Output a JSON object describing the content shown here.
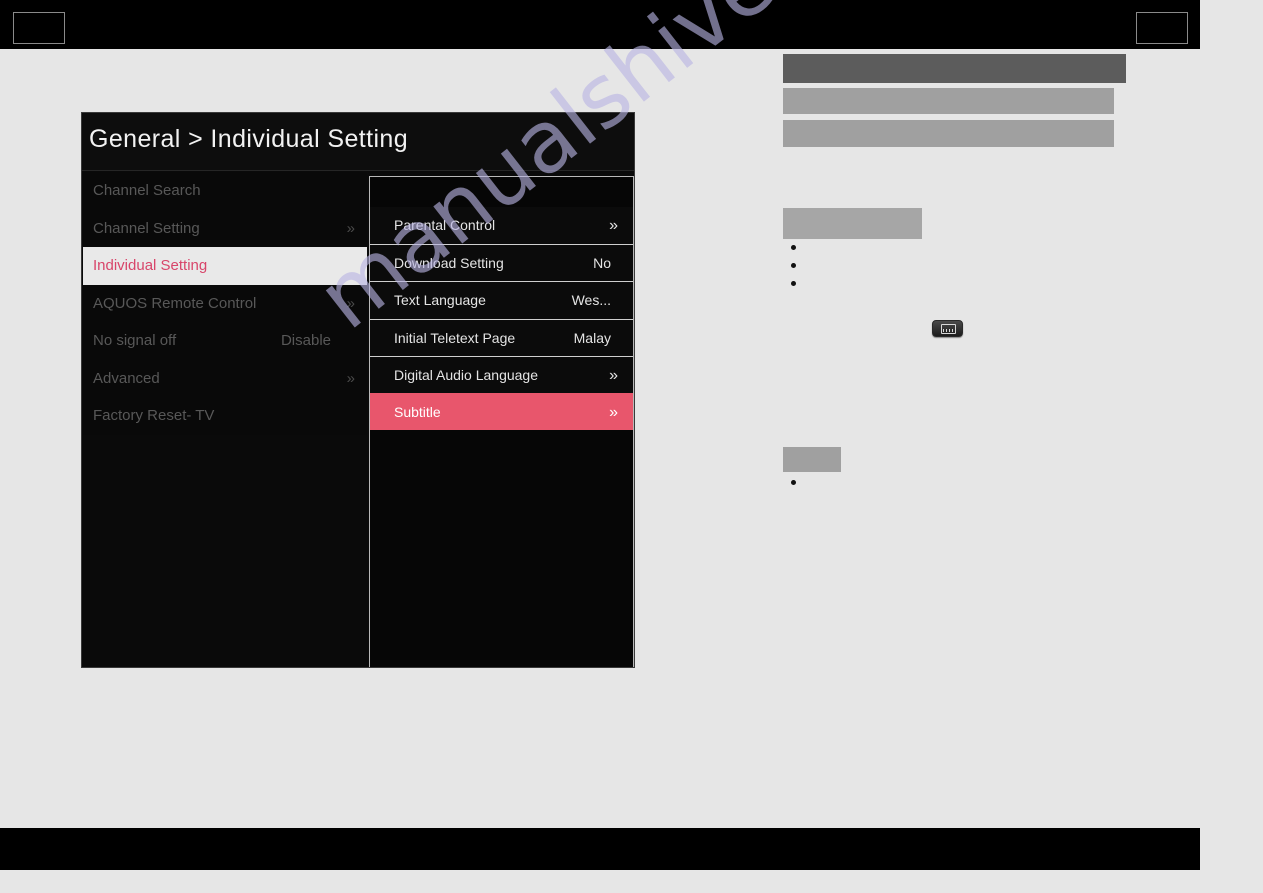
{
  "page": {
    "watermark": "manualshive.com",
    "background_color": "#e6e6e6",
    "band_color": "#000000"
  },
  "header": {
    "left_box_label": "",
    "right_box_label": ""
  },
  "osd": {
    "title": "General > Individual Setting",
    "panel_background": "#0a0a0a",
    "selected_color": "#d8456a",
    "highlight_color": "#e8566c",
    "left_menu": [
      {
        "label": "Channel Search",
        "value": "",
        "arrow": "",
        "selected": false
      },
      {
        "label": "Channel Setting",
        "value": "",
        "arrow": "»",
        "selected": false
      },
      {
        "label": "Individual Setting",
        "value": "",
        "arrow": "",
        "selected": true
      },
      {
        "label": "AQUOS Remote Control",
        "value": "",
        "arrow": "»",
        "selected": false
      },
      {
        "label": "No signal off",
        "value": "Disable",
        "arrow": "",
        "selected": false
      },
      {
        "label": "Advanced",
        "value": "",
        "arrow": "»",
        "selected": false
      },
      {
        "label": "Factory Reset- TV",
        "value": "",
        "arrow": "",
        "selected": false
      }
    ],
    "submenu": [
      {
        "label": "Parental Control",
        "value": "",
        "arrow": "»",
        "highlight": false
      },
      {
        "label": "Download Setting",
        "value": "No",
        "arrow": "",
        "highlight": false
      },
      {
        "label": "Text Language",
        "value": "Wes...",
        "arrow": "",
        "highlight": false
      },
      {
        "label": "Initial Teletext Page",
        "value": "Malay",
        "arrow": "",
        "highlight": false
      },
      {
        "label": "Digital Audio Language",
        "value": "",
        "arrow": "»",
        "highlight": false
      },
      {
        "label": "Subtitle",
        "value": "",
        "arrow": "»",
        "highlight": true
      }
    ]
  },
  "redactions": [
    {
      "name": "redacted-heading-bar",
      "color": "#5c5c5c"
    },
    {
      "name": "redacted-text-bar-1",
      "color": "#a0a0a0"
    },
    {
      "name": "redacted-text-bar-2",
      "color": "#a0a0a0"
    },
    {
      "name": "redacted-subheading",
      "color": "#a6a6a6"
    },
    {
      "name": "redacted-note-bar",
      "color": "#a0a0a0"
    }
  ],
  "remote_key": {
    "name": "subtitle-key-icon"
  }
}
